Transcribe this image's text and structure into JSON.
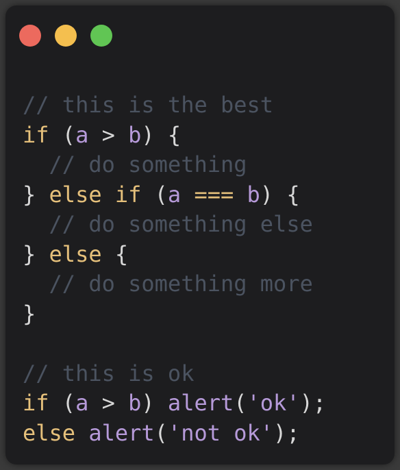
{
  "window": {
    "traffic_lights": [
      {
        "name": "close-button",
        "color": "#ec6a5e"
      },
      {
        "name": "minimize-button",
        "color": "#f4bf4f"
      },
      {
        "name": "zoom-button",
        "color": "#61c554"
      }
    ]
  },
  "colors": {
    "comment": "#4b5360",
    "keyword": "#e5c07b",
    "variable": "#b69ad9",
    "operator": "#e5c07b",
    "punctuation": "#d7d7d7",
    "function": "#b69ad9",
    "string": "#b69ad9"
  },
  "code": {
    "lines": [
      [
        {
          "t": "// this is the best",
          "k": "comment"
        }
      ],
      [
        {
          "t": "if",
          "k": "keyword"
        },
        {
          "t": " (",
          "k": "punctuation"
        },
        {
          "t": "a",
          "k": "variable"
        },
        {
          "t": " > ",
          "k": "punctuation"
        },
        {
          "t": "b",
          "k": "variable"
        },
        {
          "t": ") {",
          "k": "punctuation"
        }
      ],
      [
        {
          "t": "  // do something",
          "k": "comment"
        }
      ],
      [
        {
          "t": "} ",
          "k": "punctuation"
        },
        {
          "t": "else if",
          "k": "keyword"
        },
        {
          "t": " (",
          "k": "punctuation"
        },
        {
          "t": "a",
          "k": "variable"
        },
        {
          "t": " ",
          "k": "punctuation"
        },
        {
          "t": "===",
          "k": "operator"
        },
        {
          "t": " ",
          "k": "punctuation"
        },
        {
          "t": "b",
          "k": "variable"
        },
        {
          "t": ") {",
          "k": "punctuation"
        }
      ],
      [
        {
          "t": "  // do something else",
          "k": "comment"
        }
      ],
      [
        {
          "t": "} ",
          "k": "punctuation"
        },
        {
          "t": "else",
          "k": "keyword"
        },
        {
          "t": " {",
          "k": "punctuation"
        }
      ],
      [
        {
          "t": "  // do something more",
          "k": "comment"
        }
      ],
      [
        {
          "t": "}",
          "k": "punctuation"
        }
      ],
      [
        {
          "t": "",
          "k": "punctuation"
        }
      ],
      [
        {
          "t": "// this is ok",
          "k": "comment"
        }
      ],
      [
        {
          "t": "if",
          "k": "keyword"
        },
        {
          "t": " (",
          "k": "punctuation"
        },
        {
          "t": "a",
          "k": "variable"
        },
        {
          "t": " > ",
          "k": "punctuation"
        },
        {
          "t": "b",
          "k": "variable"
        },
        {
          "t": ") ",
          "k": "punctuation"
        },
        {
          "t": "alert",
          "k": "function"
        },
        {
          "t": "(",
          "k": "punctuation"
        },
        {
          "t": "'ok'",
          "k": "string"
        },
        {
          "t": ");",
          "k": "punctuation"
        }
      ],
      [
        {
          "t": "else",
          "k": "keyword"
        },
        {
          "t": " ",
          "k": "punctuation"
        },
        {
          "t": "alert",
          "k": "function"
        },
        {
          "t": "(",
          "k": "punctuation"
        },
        {
          "t": "'not ok'",
          "k": "string"
        },
        {
          "t": ");",
          "k": "punctuation"
        }
      ]
    ]
  }
}
